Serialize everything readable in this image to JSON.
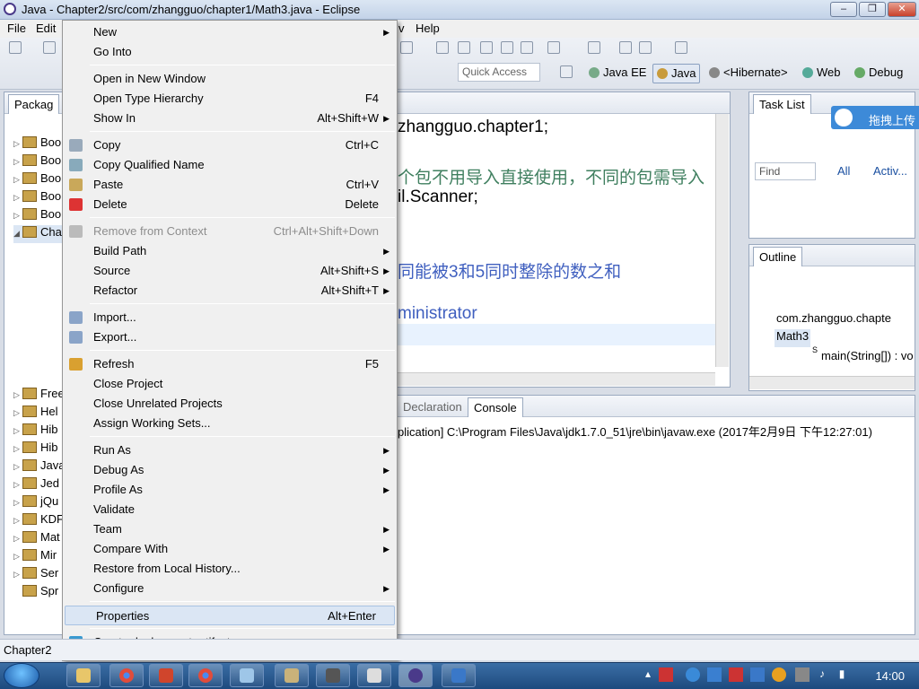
{
  "window": {
    "title": "Java - Chapter2/src/com/zhangguo/chapter1/Math3.java - Eclipse"
  },
  "menubar": {
    "items": [
      "File",
      "Edit",
      "v",
      "Help"
    ]
  },
  "quick_access": {
    "placeholder": "Quick Access"
  },
  "perspectives": [
    "Java EE",
    "Java",
    "<Hibernate>",
    "Web",
    "Debug"
  ],
  "package_explorer": {
    "tab": "Packag",
    "rows": [
      "Boo",
      "Boo",
      "Boo",
      "Boo",
      "Boo",
      "Chap",
      "",
      "",
      "",
      "",
      "",
      "",
      "",
      "",
      "Free",
      "Hel",
      "Hib",
      "Hib",
      "Java",
      "Jed",
      "jQu",
      "KDF",
      "Mat",
      "Mir",
      "Ser",
      "Spr"
    ]
  },
  "editor": {
    "lines": [
      {
        "text": "zhangguo.chapter1;",
        "style": "normal"
      },
      {
        "text": "个包不用导入直接使用，不同的包需导入",
        "style": "green"
      },
      {
        "text": "il.Scanner;",
        "style": "normal"
      },
      {
        "text": "同能被3和5同时整除的数之和",
        "style": "blue"
      },
      {
        "text": "ministrator",
        "style": "blue"
      }
    ]
  },
  "console": {
    "tab_declaration": "Declaration",
    "tab_console": "Console",
    "status_line": "plication] C:\\Program Files\\Java\\jdk1.7.0_51\\jre\\bin\\javaw.exe (2017年2月9日 下午12:27:01)"
  },
  "task_list": {
    "tab": "Task List",
    "find_placeholder": "Find",
    "all": "All",
    "activ": "Activ..."
  },
  "outline": {
    "tab": "Outline",
    "items": [
      "com.zhangguo.chapte",
      "Math3",
      "main(String[]) : vo"
    ],
    "main_modifier": "S"
  },
  "upload_button": {
    "label": "拖拽上传"
  },
  "context_menu": {
    "groups": [
      [
        {
          "label": "New",
          "shortcut": "",
          "submenu": true,
          "disabled": false
        },
        {
          "label": "Go Into",
          "shortcut": "",
          "submenu": false,
          "disabled": false
        }
      ],
      [
        {
          "label": "Open in New Window",
          "shortcut": "",
          "submenu": false,
          "disabled": false
        },
        {
          "label": "Open Type Hierarchy",
          "shortcut": "F4",
          "submenu": false,
          "disabled": false
        },
        {
          "label": "Show In",
          "shortcut": "Alt+Shift+W",
          "submenu": true,
          "disabled": false
        }
      ],
      [
        {
          "label": "Copy",
          "shortcut": "Ctrl+C",
          "submenu": false,
          "disabled": false
        },
        {
          "label": "Copy Qualified Name",
          "shortcut": "",
          "submenu": false,
          "disabled": false
        },
        {
          "label": "Paste",
          "shortcut": "Ctrl+V",
          "submenu": false,
          "disabled": false
        },
        {
          "label": "Delete",
          "shortcut": "Delete",
          "submenu": false,
          "disabled": false
        }
      ],
      [
        {
          "label": "Remove from Context",
          "shortcut": "Ctrl+Alt+Shift+Down",
          "submenu": false,
          "disabled": true
        },
        {
          "label": "Build Path",
          "shortcut": "",
          "submenu": true,
          "disabled": false
        },
        {
          "label": "Source",
          "shortcut": "Alt+Shift+S",
          "submenu": true,
          "disabled": false
        },
        {
          "label": "Refactor",
          "shortcut": "Alt+Shift+T",
          "submenu": true,
          "disabled": false
        }
      ],
      [
        {
          "label": "Import...",
          "shortcut": "",
          "submenu": false,
          "disabled": false
        },
        {
          "label": "Export...",
          "shortcut": "",
          "submenu": false,
          "disabled": false
        }
      ],
      [
        {
          "label": "Refresh",
          "shortcut": "F5",
          "submenu": false,
          "disabled": false
        },
        {
          "label": "Close Project",
          "shortcut": "",
          "submenu": false,
          "disabled": false
        },
        {
          "label": "Close Unrelated Projects",
          "shortcut": "",
          "submenu": false,
          "disabled": false
        },
        {
          "label": "Assign Working Sets...",
          "shortcut": "",
          "submenu": false,
          "disabled": false
        }
      ],
      [
        {
          "label": "Run As",
          "shortcut": "",
          "submenu": true,
          "disabled": false
        },
        {
          "label": "Debug As",
          "shortcut": "",
          "submenu": true,
          "disabled": false
        },
        {
          "label": "Profile As",
          "shortcut": "",
          "submenu": true,
          "disabled": false
        },
        {
          "label": "Validate",
          "shortcut": "",
          "submenu": false,
          "disabled": false
        },
        {
          "label": "Team",
          "shortcut": "",
          "submenu": true,
          "disabled": false
        },
        {
          "label": "Compare With",
          "shortcut": "",
          "submenu": true,
          "disabled": false
        },
        {
          "label": "Restore from Local History...",
          "shortcut": "",
          "submenu": false,
          "disabled": false
        },
        {
          "label": "Configure",
          "shortcut": "",
          "submenu": true,
          "disabled": false
        }
      ],
      [
        {
          "label": "Properties",
          "shortcut": "Alt+Enter",
          "submenu": false,
          "disabled": false,
          "highlighted": true
        }
      ],
      [
        {
          "label": "Create deployment artifacts",
          "shortcut": "",
          "submenu": false,
          "disabled": false
        }
      ]
    ]
  },
  "statusbar": {
    "text": "Chapter2"
  },
  "clock": {
    "time": "14:00"
  },
  "colors": {
    "accent": "#3d8ad8",
    "taskbar": "#1d4a7e",
    "code_comment": "#3f7f5f",
    "javadoc": "#3f5fbf"
  }
}
